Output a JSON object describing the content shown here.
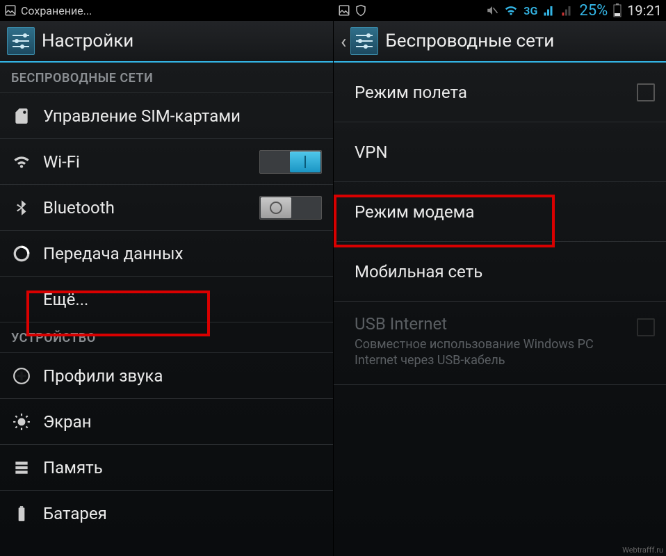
{
  "left": {
    "statusbar": {
      "text": "Сохранение..."
    },
    "header": {
      "title": "Настройки"
    },
    "sections": {
      "wireless_header": "БЕСПРОВОДНЫЕ СЕТИ",
      "device_header": "УСТРОЙСТВО"
    },
    "items": {
      "sim": "Управление SIM-картами",
      "wifi": "Wi-Fi",
      "bluetooth": "Bluetooth",
      "data": "Передача данных",
      "more": "Ещё...",
      "sound": "Профили звука",
      "display": "Экран",
      "storage": "Память",
      "battery": "Батарея"
    }
  },
  "right": {
    "statusbar": {
      "network": "3G",
      "battery_pct": "25%",
      "time": "19:21"
    },
    "header": {
      "title": "Беспроводные сети"
    },
    "items": {
      "airplane": "Режим полета",
      "vpn": "VPN",
      "tether": "Режим модема",
      "mobile": "Мобильная сеть",
      "usb_title": "USB Internet",
      "usb_sub": "Совместное использование Windows PC Internet через USB-кабель"
    }
  },
  "watermark": "Webtrafff.ru"
}
